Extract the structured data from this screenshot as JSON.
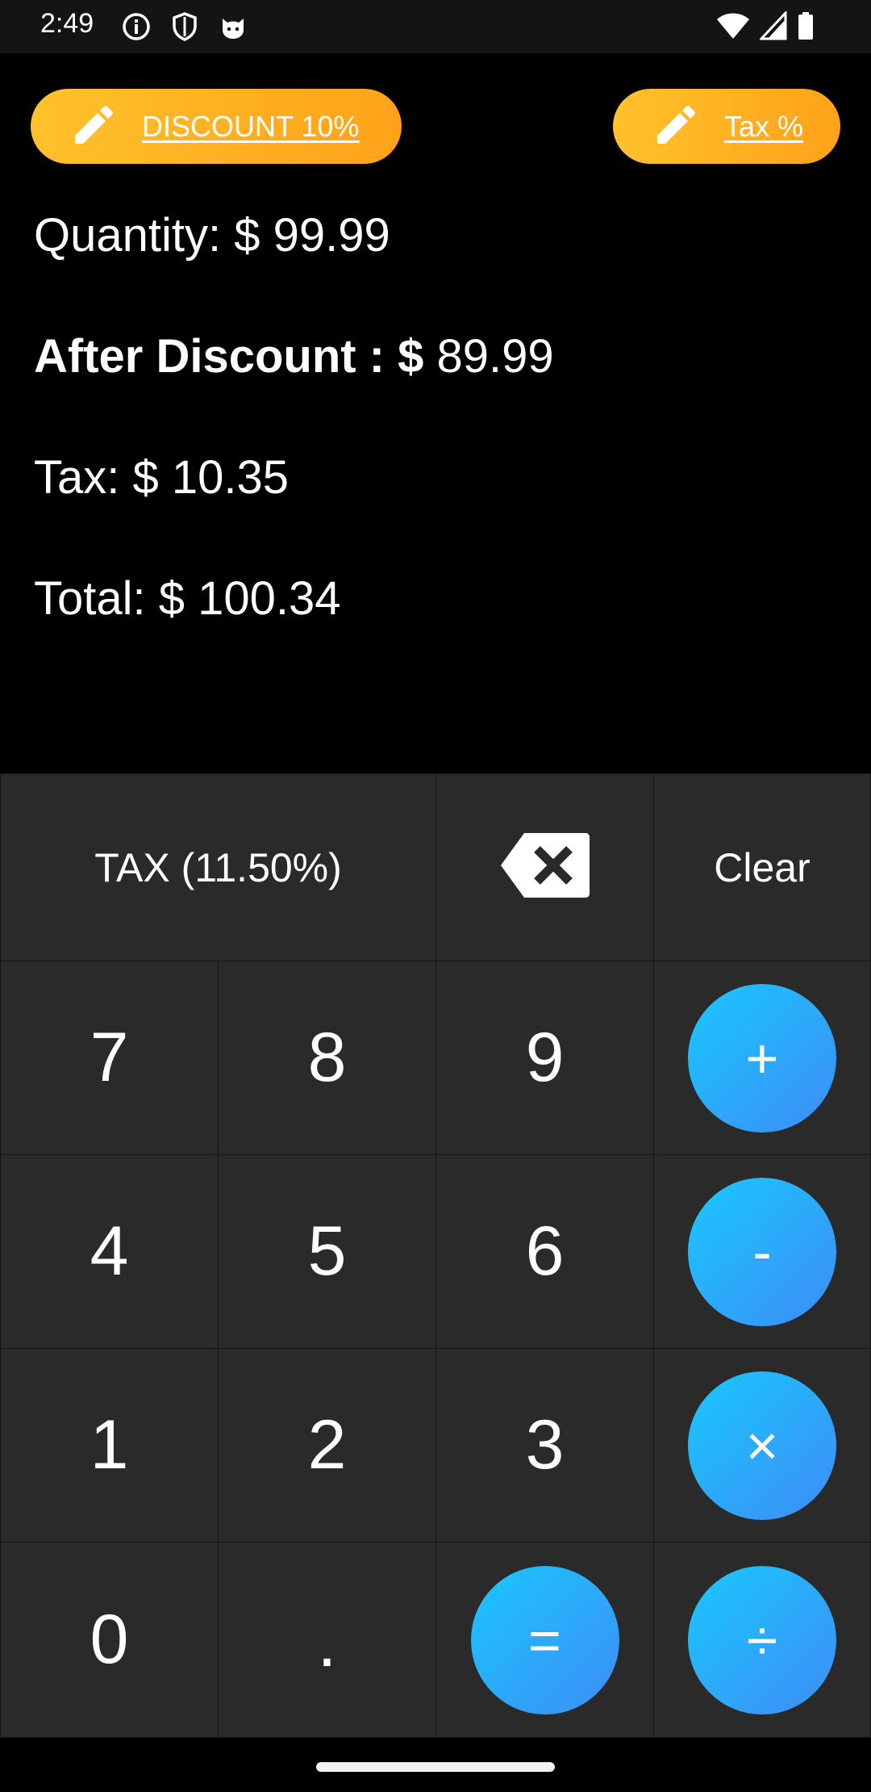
{
  "status_bar": {
    "time": "2:49",
    "left_icons": [
      "info-icon",
      "shield-icon",
      "cat-icon"
    ],
    "right_icons": [
      "wifi-icon",
      "signal-icon",
      "battery-icon"
    ]
  },
  "buttons": {
    "discount": {
      "label": "DISCOUNT 10%",
      "icon": "pencil-icon"
    },
    "tax": {
      "label": "Tax %",
      "icon": "pencil-icon"
    }
  },
  "results": {
    "quantity_label": "Quantity: ",
    "quantity_value": "$ 99.99",
    "after_discount_label": "After Discount : $",
    "after_discount_value": " 89.99",
    "tax_label": "Tax: ",
    "tax_value": "$ 10.35",
    "total_label": "Total: ",
    "total_value": "$ 100.34"
  },
  "keypad": {
    "tax_key": "TAX (11.50%)",
    "backspace_icon": "backspace-icon",
    "clear_key": "Clear",
    "digits": {
      "seven": "7",
      "eight": "8",
      "nine": "9",
      "four": "4",
      "five": "5",
      "six": "6",
      "one": "1",
      "two": "2",
      "three": "3",
      "zero": "0",
      "dot": "."
    },
    "ops": {
      "plus": "+",
      "minus": "-",
      "multiply": "×",
      "divide": "÷",
      "equals": "="
    }
  },
  "colors": {
    "accent_orange": "#ffb020",
    "accent_blue": "#2aa6f8",
    "key_bg": "#2a2a2a"
  }
}
